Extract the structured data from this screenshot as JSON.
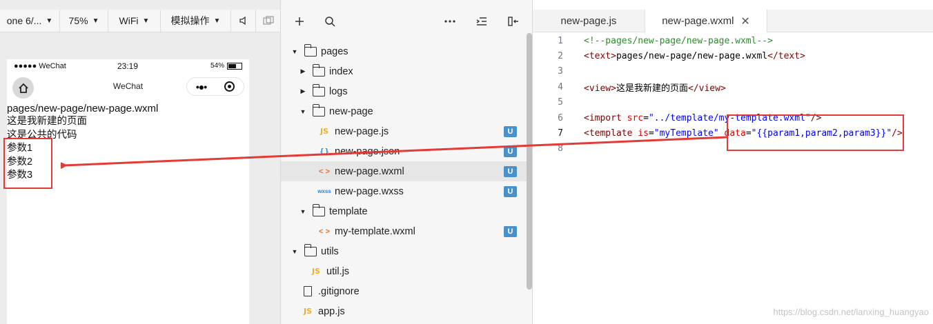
{
  "simulator": {
    "toolbar": {
      "device": "one 6/...",
      "zoom": "75%",
      "network": "WiFi",
      "simulate_op": "模拟操作"
    },
    "status_bar": {
      "carrier": "●●●●● WeChat",
      "time": "23:19",
      "battery": "54%"
    },
    "nav_bar": {
      "title": "WeChat",
      "more": "•●•"
    },
    "page": {
      "path": "pages/new-page/new-page.wxml",
      "line1": "这是我新建的页面",
      "line2": "这是公共的代码",
      "params": [
        "参数1",
        "参数2",
        "参数3"
      ]
    }
  },
  "explorer": {
    "items": [
      {
        "label": "pages",
        "kind": "folder-open",
        "depth": 0
      },
      {
        "label": "index",
        "kind": "folder",
        "depth": 1
      },
      {
        "label": "logs",
        "kind": "folder",
        "depth": 1
      },
      {
        "label": "new-page",
        "kind": "folder-open",
        "depth": 1
      },
      {
        "label": "new-page.js",
        "kind": "js",
        "depth": 2,
        "badge": "U"
      },
      {
        "label": "new-page.json",
        "kind": "json",
        "depth": 2,
        "badge": "U"
      },
      {
        "label": "new-page.wxml",
        "kind": "wxml",
        "depth": 2,
        "badge": "U",
        "selected": true
      },
      {
        "label": "new-page.wxss",
        "kind": "wxss",
        "depth": 2,
        "badge": "U"
      },
      {
        "label": "template",
        "kind": "folder-open",
        "depth": 1
      },
      {
        "label": "my-template.wxml",
        "kind": "wxml",
        "depth": 2,
        "badge": "U"
      },
      {
        "label": "utils",
        "kind": "folder-open",
        "depth": 0
      },
      {
        "label": "util.js",
        "kind": "js",
        "depth": 1
      },
      {
        "label": ".gitignore",
        "kind": "file",
        "depth": 0
      },
      {
        "label": "app.js",
        "kind": "js",
        "depth": 0
      }
    ],
    "icon_glyphs": {
      "js": "JS",
      "json": "{ }",
      "wxml": "< >",
      "wxss": "wxss"
    }
  },
  "editor": {
    "tabs": [
      {
        "label": "new-page.js",
        "active": false
      },
      {
        "label": "new-page.wxml",
        "active": true
      }
    ],
    "close_glyph": "✕",
    "lines": [
      {
        "n": "1",
        "tokens": [
          {
            "t": "<!--pages/new-page/new-page.wxml-->",
            "c": "com"
          }
        ]
      },
      {
        "n": "2",
        "tokens": [
          {
            "t": "<text>",
            "c": "tag"
          },
          {
            "t": "pages/new-page/new-page.wxml",
            "c": "txt"
          },
          {
            "t": "</text>",
            "c": "tag"
          }
        ]
      },
      {
        "n": "3",
        "tokens": []
      },
      {
        "n": "4",
        "tokens": [
          {
            "t": "<view>",
            "c": "tag"
          },
          {
            "t": "这是我新建的页面",
            "c": "txt"
          },
          {
            "t": "</view>",
            "c": "tag"
          }
        ]
      },
      {
        "n": "5",
        "tokens": []
      },
      {
        "n": "6",
        "tokens": [
          {
            "t": "<import ",
            "c": "tag"
          },
          {
            "t": "src",
            "c": "attr"
          },
          {
            "t": "=",
            "c": "txt"
          },
          {
            "t": "\"../template/my-template.wxml\"",
            "c": "str"
          },
          {
            "t": "/>",
            "c": "tag"
          }
        ]
      },
      {
        "n": "7",
        "tokens": [
          {
            "t": "<template ",
            "c": "tag"
          },
          {
            "t": "is",
            "c": "attr"
          },
          {
            "t": "=",
            "c": "txt"
          },
          {
            "t": "\"myTemplate\"",
            "c": "str"
          },
          {
            "t": " ",
            "c": "txt"
          },
          {
            "t": "data",
            "c": "attr"
          },
          {
            "t": "=",
            "c": "txt"
          },
          {
            "t": "\"{{param1,param2,param3}}\"",
            "c": "str"
          },
          {
            "t": "/>",
            "c": "tag"
          }
        ],
        "current": true
      },
      {
        "n": "8",
        "tokens": []
      }
    ],
    "watermark": "https://blog.csdn.net/lanxing_huangyao"
  },
  "colors": {
    "annotation": "#e53935",
    "badge": "#4a90c9"
  }
}
